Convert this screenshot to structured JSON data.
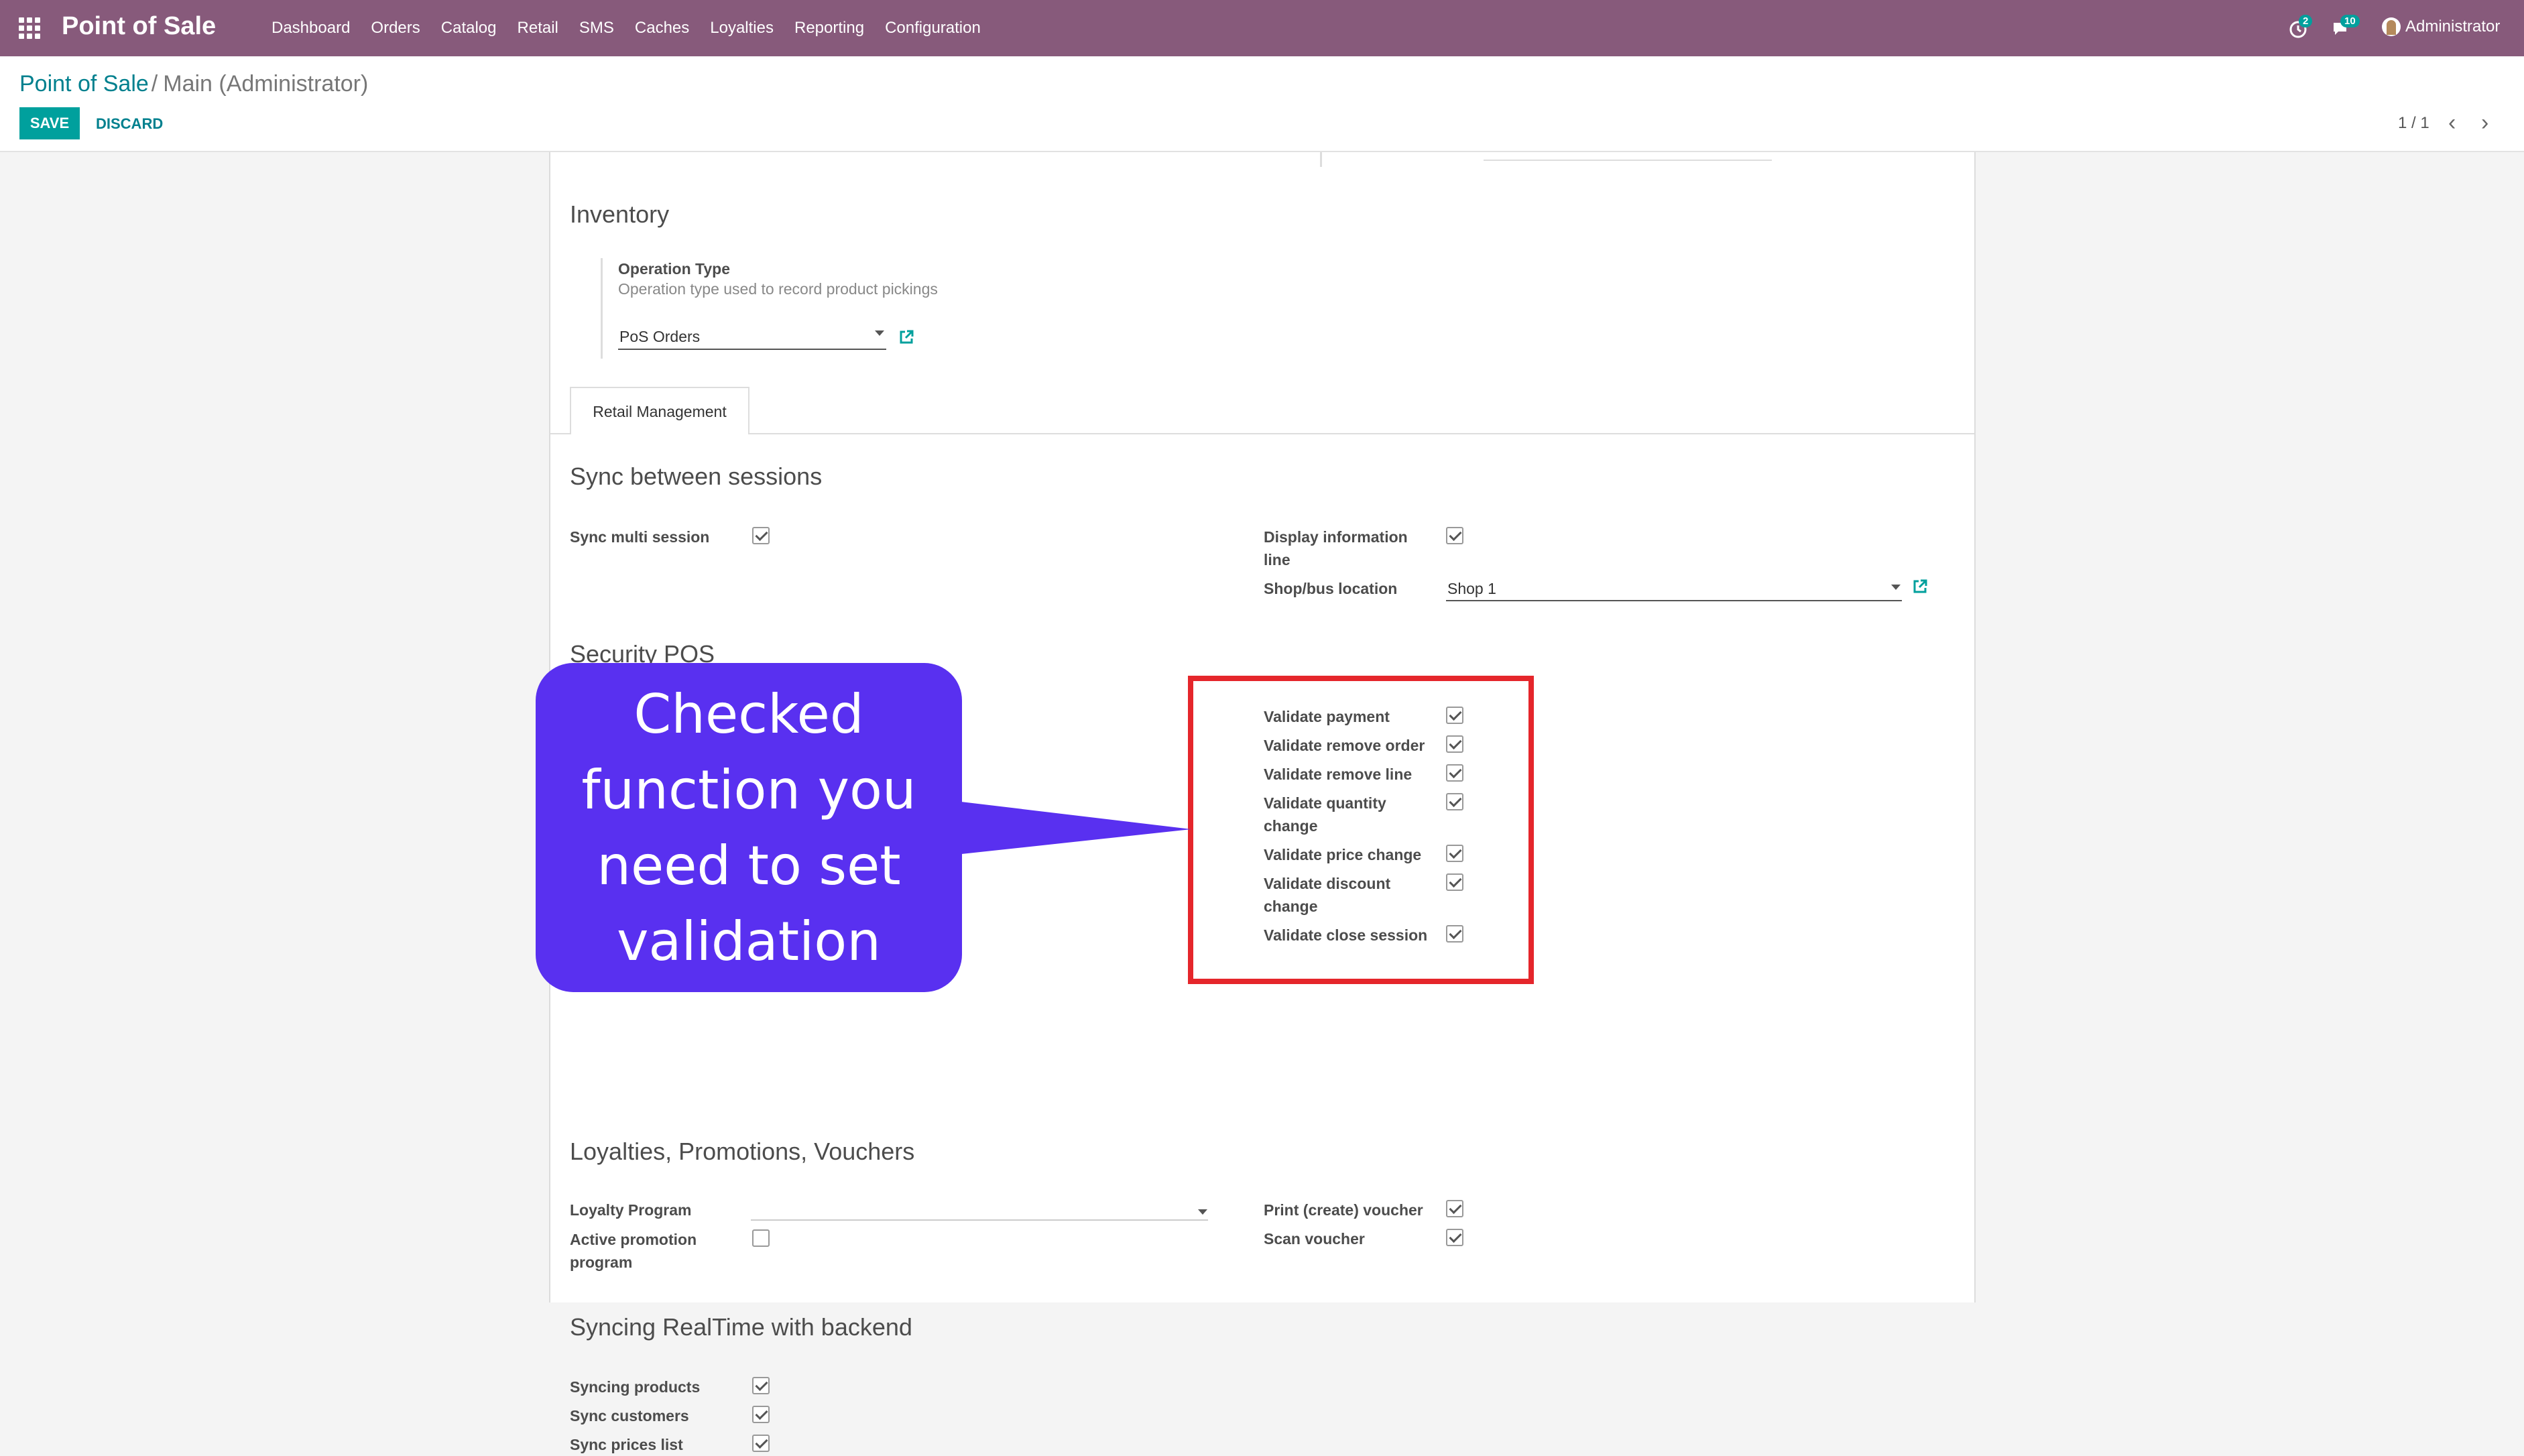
{
  "navbar": {
    "app_title": "Point of Sale",
    "menu": [
      "Dashboard",
      "Orders",
      "Catalog",
      "Retail",
      "SMS",
      "Caches",
      "Loyalties",
      "Reporting",
      "Configuration"
    ],
    "activity_count": "2",
    "message_count": "10",
    "user": "Administrator",
    "bg_color": "#875a7b"
  },
  "breadcrumb": {
    "parent": "Point of Sale",
    "separator": "/",
    "current": "Main (Administrator)"
  },
  "actions": {
    "save": "SAVE",
    "discard": "DISCARD"
  },
  "pager": {
    "value": "1 / 1"
  },
  "inventory": {
    "title": "Inventory",
    "operation_type_label": "Operation Type",
    "operation_type_help": "Operation type used to record product pickings",
    "operation_type_value": "PoS Orders"
  },
  "tabs": [
    "Retail Management"
  ],
  "sync_sessions": {
    "title": "Sync between sessions",
    "sync_multi_session": {
      "label": "Sync multi session",
      "checked": true
    },
    "display_info_line": {
      "label_1": "Display information",
      "label_2": "line",
      "checked": true
    },
    "shop_bus_location": {
      "label": "Shop/bus location",
      "value": "Shop 1"
    }
  },
  "security": {
    "title": "Security POS",
    "items": [
      {
        "label": "Validate payment",
        "checked": true
      },
      {
        "label": "Validate remove order",
        "checked": true
      },
      {
        "label": "Validate remove line",
        "checked": true
      },
      {
        "label": "Validate quantity",
        "label_2": "change",
        "checked": true
      },
      {
        "label": "Validate price change",
        "checked": true
      },
      {
        "label": "Validate discount",
        "label_2": "change",
        "checked": true
      },
      {
        "label": "Validate close session",
        "checked": true
      }
    ]
  },
  "loyalties": {
    "title": "Loyalties, Promotions, Vouchers",
    "loyalty_program": {
      "label": "Loyalty Program",
      "value": ""
    },
    "active_promotion": {
      "label_1": "Active promotion",
      "label_2": "program",
      "checked": false
    },
    "print_voucher": {
      "label": "Print (create) voucher",
      "checked": true
    },
    "scan_voucher": {
      "label": "Scan voucher",
      "checked": true
    }
  },
  "realtime": {
    "title": "Syncing RealTime with backend",
    "items": [
      {
        "label": "Syncing products",
        "checked": true
      },
      {
        "label": "Sync customers",
        "checked": true
      },
      {
        "label": "Sync prices list",
        "checked": true
      }
    ]
  },
  "annotation": {
    "callout_text_lines": [
      "Checked",
      "function you",
      "need to set",
      "validation"
    ],
    "callout_color": "#5930f0",
    "highlight_color": "#e5262b"
  }
}
